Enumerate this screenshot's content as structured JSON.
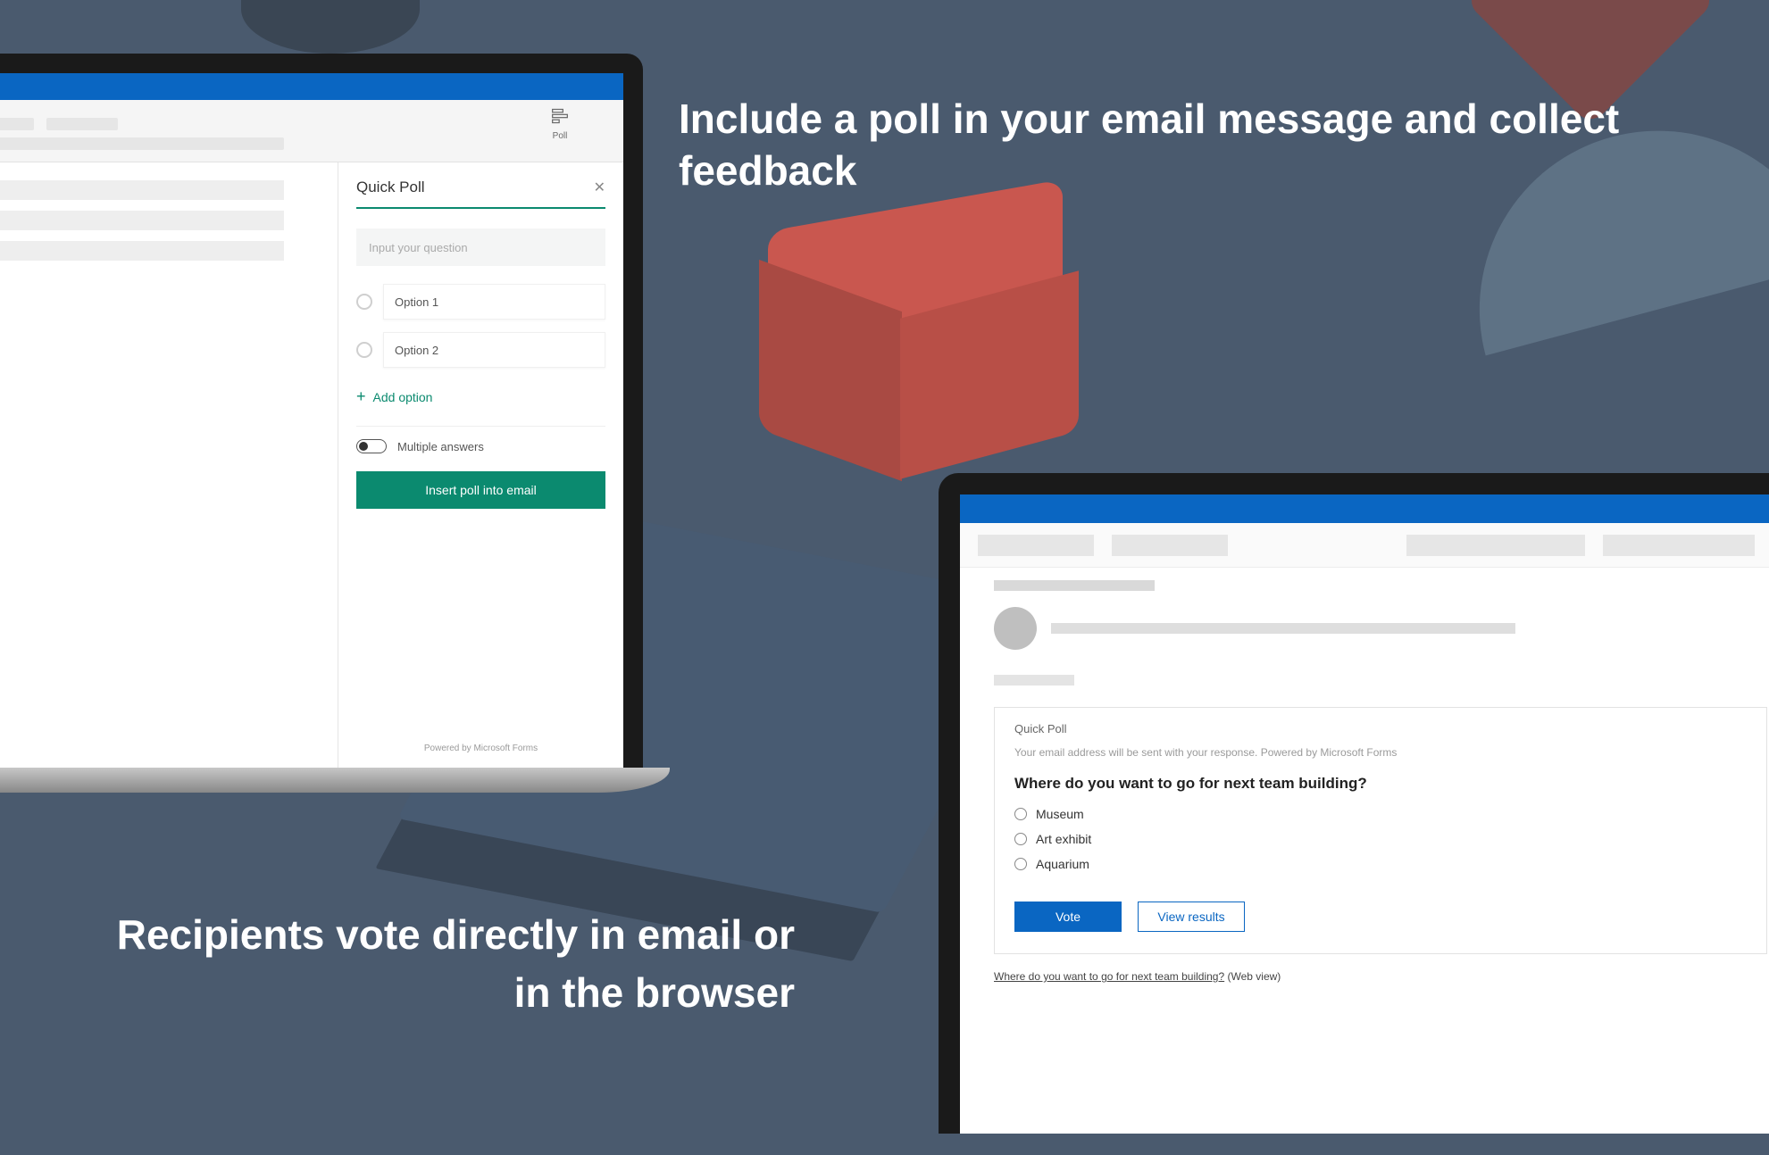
{
  "headlines": {
    "top": "Include a poll in your email message and collect feedback",
    "bottom": "Recipients vote directly in email or in the browser"
  },
  "colors": {
    "outlook_blue": "#0a66c2",
    "forms_teal": "#0b8a6f",
    "accent_red": "#c9574f"
  },
  "compose": {
    "toolbar_poll_label": "Poll",
    "quick_poll": {
      "title": "Quick Poll",
      "question_placeholder": "Input your question",
      "options": [
        "Option 1",
        "Option 2"
      ],
      "add_option_label": "Add option",
      "multiple_answers_label": "Multiple answers",
      "multiple_answers_on": false,
      "insert_button_label": "Insert poll into email",
      "footer": "Powered by Microsoft Forms"
    }
  },
  "received": {
    "poll_card": {
      "title": "Quick Poll",
      "note": "Your email address will be sent with your response. Powered by Microsoft Forms",
      "question": "Where do you want to go for next team building?",
      "options": [
        "Museum",
        "Art exhibit",
        "Aquarium"
      ],
      "vote_label": "Vote",
      "view_results_label": "View results"
    },
    "footer_link_text": "Where do you want to go for next team building?",
    "footer_suffix": " (Web view)"
  }
}
